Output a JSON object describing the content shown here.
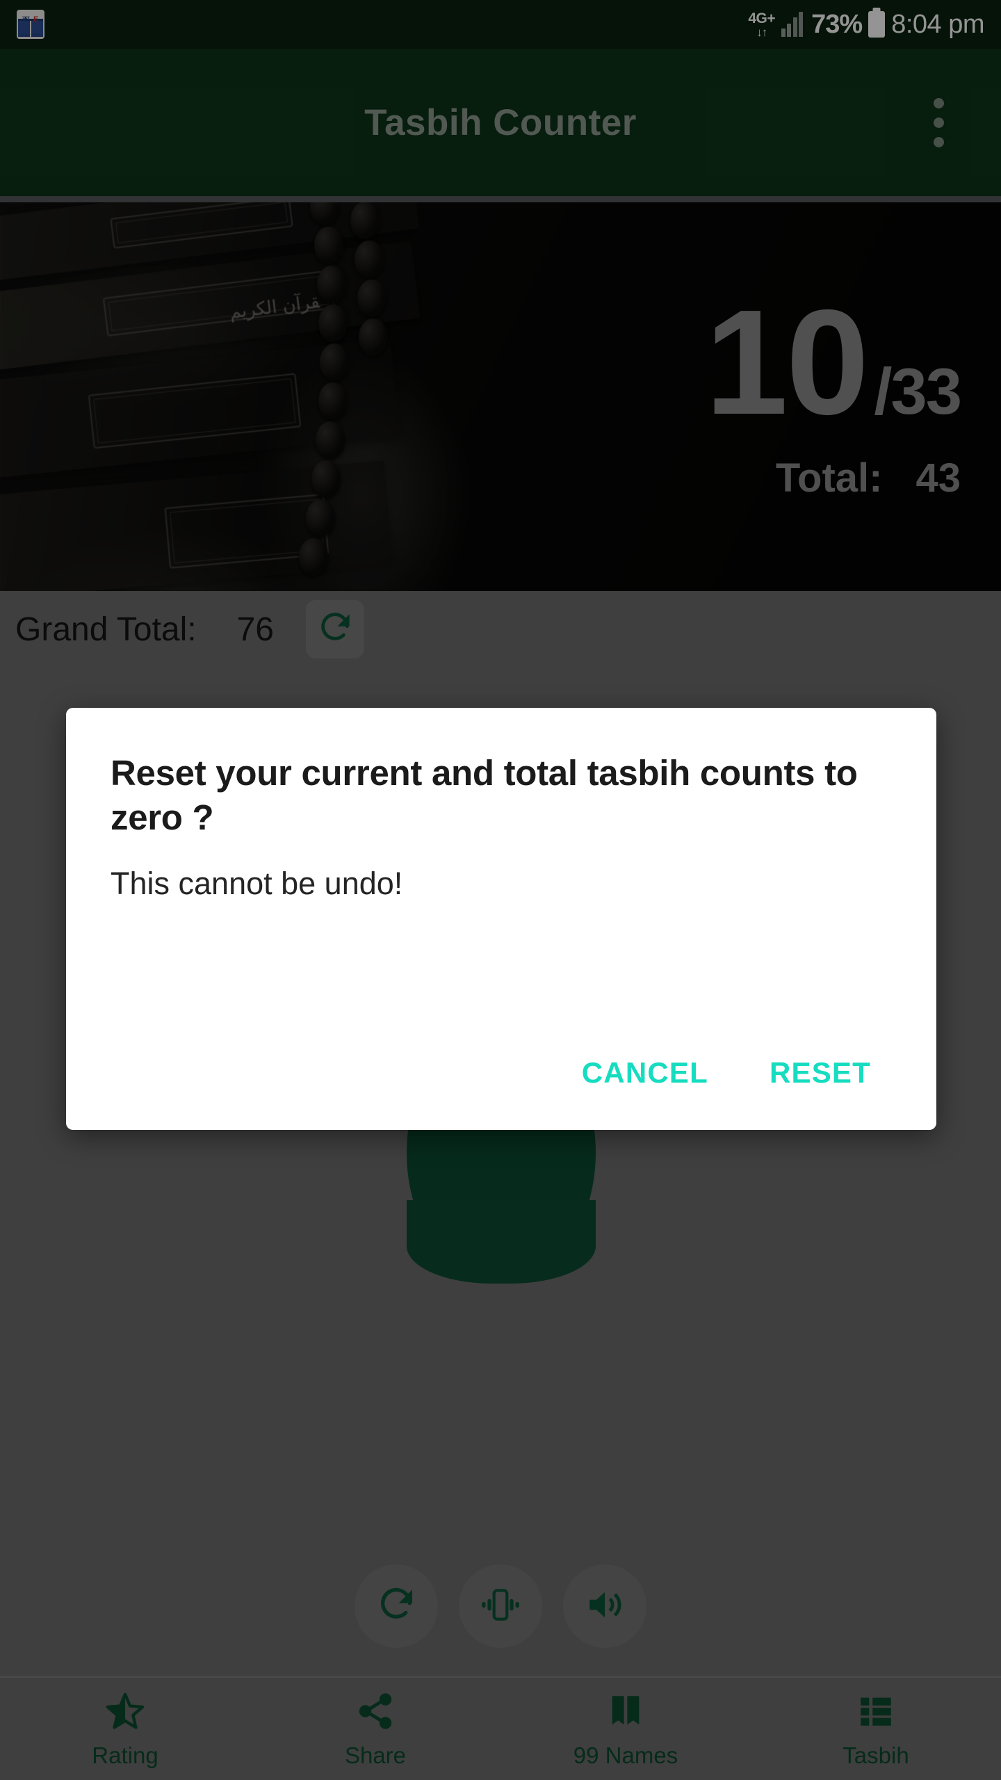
{
  "status_bar": {
    "notification_icon": "dictionary-app-icon",
    "notification_glyphs": "অ E",
    "notification_caption": "BNG ENG",
    "network_type": "4G+",
    "data_arrows": "↓↑",
    "signal_icon": "signal-bars-icon",
    "battery_percent": "73%",
    "battery_icon": "battery-icon",
    "time": "8:04 pm"
  },
  "app_bar": {
    "title": "Tasbih Counter",
    "overflow_icon": "more-vertical-icon"
  },
  "hero": {
    "image_alt": "quran-books-with-prayer-beads",
    "arabic_text": "القرآن الكريم",
    "current_count": "10",
    "goal_count": "/33",
    "total_label": "Total:",
    "total_value": "43"
  },
  "grand_total": {
    "label": "Grand Total:",
    "value": "76",
    "reset_icon": "refresh-icon"
  },
  "controls": [
    {
      "name": "reset-control",
      "icon": "refresh-icon"
    },
    {
      "name": "vibrate-control",
      "icon": "vibration-icon"
    },
    {
      "name": "sound-control",
      "icon": "volume-up-icon"
    }
  ],
  "bottom_nav": [
    {
      "label": "Rating",
      "icon": "star-half-icon"
    },
    {
      "label": "Share",
      "icon": "share-icon"
    },
    {
      "label": "99 Names",
      "icon": "book-icon"
    },
    {
      "label": "Tasbih",
      "icon": "list-icon"
    }
  ],
  "dialog": {
    "title": "Reset your current and total tasbih counts to zero ?",
    "message": "This cannot be undo!",
    "cancel_label": "CANCEL",
    "reset_label": "RESET"
  },
  "colors": {
    "status_bar_bg": "#0a2210",
    "app_bar_bg": "#0d3319",
    "accent_green": "#0c4b2e",
    "dialog_action": "#16dcc0",
    "scrim": "rgba(0,0,0,0.42)"
  }
}
